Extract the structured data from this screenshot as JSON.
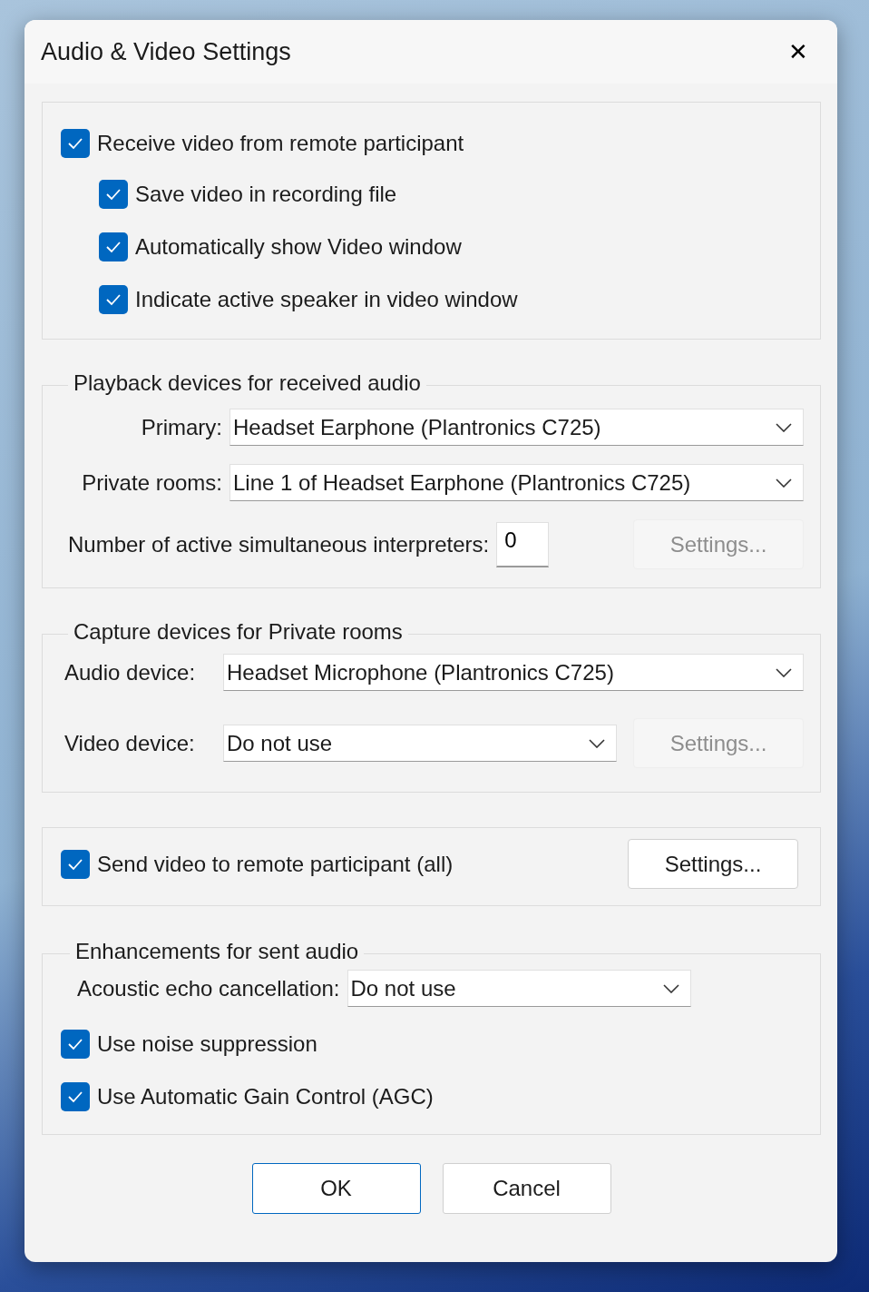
{
  "window": {
    "title": "Audio & Video Settings",
    "close": "✕"
  },
  "groups": [
    {
      "kind": "options",
      "items": [
        {
          "label": "Receive video from remote participant",
          "checked": true,
          "children": [
            {
              "label": "Save video in recording file",
              "checked": true
            },
            {
              "label": "Automatically show Video window",
              "checked": true
            },
            {
              "label": "Indicate active speaker in video window",
              "checked": true
            }
          ]
        }
      ]
    },
    {
      "kind": "playback",
      "title": "Playback devices for received audio",
      "rows": [
        {
          "label": "Primary:",
          "value": "Headset Earphone (Plantronics C725)"
        },
        {
          "label": "Private rooms:",
          "value": "Line 1 of Headset Earphone (Plantronics C725)"
        }
      ],
      "interpreters": {
        "label": "Number of active simultaneous interpreters:",
        "value": "0"
      },
      "settings": {
        "label": "Settings...",
        "disabled": true
      }
    },
    {
      "kind": "capture",
      "title": "Capture devices for Private rooms",
      "audio": {
        "label": "Audio device:",
        "value": "Headset Microphone (Plantronics C725)"
      },
      "video": {
        "label": "Video device:",
        "value": "Do not use"
      },
      "settings": {
        "label": "Settings...",
        "disabled": true
      }
    },
    {
      "kind": "send",
      "checkbox": {
        "label": "Send video to remote participant (all)",
        "checked": true
      },
      "settings": {
        "label": "Settings...",
        "disabled": false
      }
    },
    {
      "kind": "enhancements",
      "title": "Enhancements for sent audio",
      "echo": {
        "label": "Acoustic echo cancellation:",
        "value": "Do not use"
      },
      "checkboxes": [
        {
          "label": "Use noise suppression",
          "checked": true
        },
        {
          "label": "Use Automatic Gain Control (AGC)",
          "checked": true
        }
      ]
    }
  ],
  "buttons": [
    {
      "label": "OK",
      "default": true
    },
    {
      "label": "Cancel",
      "default": false
    }
  ]
}
